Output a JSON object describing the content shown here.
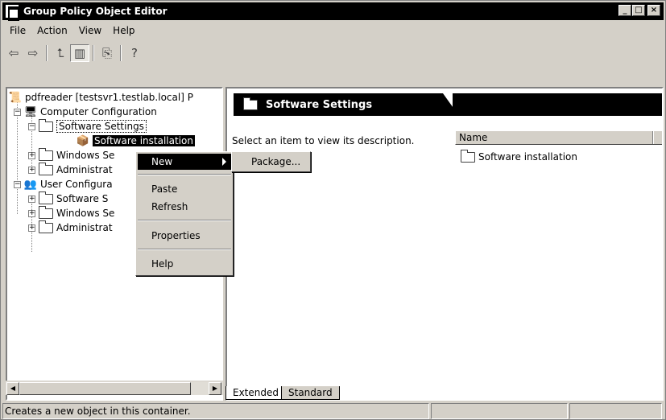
{
  "window": {
    "title": "Group Policy Object Editor"
  },
  "menubar": {
    "items": [
      "File",
      "Action",
      "View",
      "Help"
    ]
  },
  "toolbar": {
    "icons": [
      "back-icon",
      "forward-icon",
      "up-folder-icon",
      "show-hide-tree-icon",
      "export-list-icon",
      "help-icon"
    ]
  },
  "tree": {
    "root": "pdfreader [testsvr1.testlab.local] P",
    "computer_config": "Computer Configuration",
    "software_settings": "Software Settings",
    "software_installation": "Software installation",
    "windows_settings_1": "Windows Se",
    "admin_templates_1": "Administrat",
    "user_config": "User Configura",
    "software_settings_2": "Software S",
    "windows_settings_2": "Windows Se",
    "admin_templates_2": "Administrat"
  },
  "right_pane": {
    "header": "Software Settings",
    "description": "Select an item to view its description.",
    "column_name": "Name",
    "items": [
      "Software installation"
    ]
  },
  "context_menu": {
    "new": "New",
    "paste": "Paste",
    "refresh": "Refresh",
    "properties": "Properties",
    "help": "Help"
  },
  "submenu": {
    "package": "Package..."
  },
  "tabs": [
    "Extended",
    "Standard"
  ],
  "statusbar": {
    "text": "Creates a new object in this container."
  }
}
